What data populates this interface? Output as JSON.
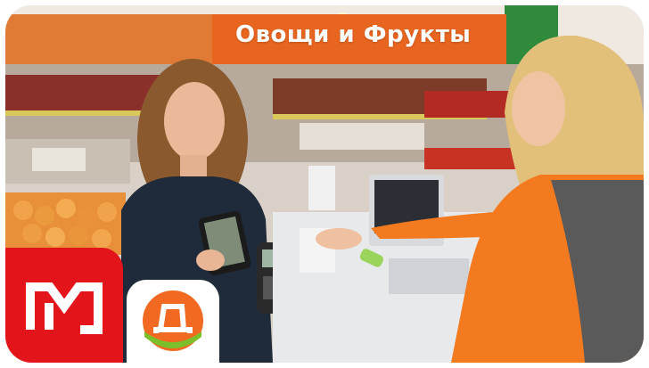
{
  "store_sign": {
    "text": "Овощи и Фрукты"
  },
  "logos": {
    "magnit": {
      "text": "М"
    },
    "dixy": {
      "text": "Д"
    }
  },
  "colors": {
    "sign_orange": "#e8651f",
    "magnit_red": "#e3151b",
    "dixy_orange": "#f26a21",
    "dixy_green": "#7bbf2a",
    "vest_orange": "#f47a20"
  }
}
